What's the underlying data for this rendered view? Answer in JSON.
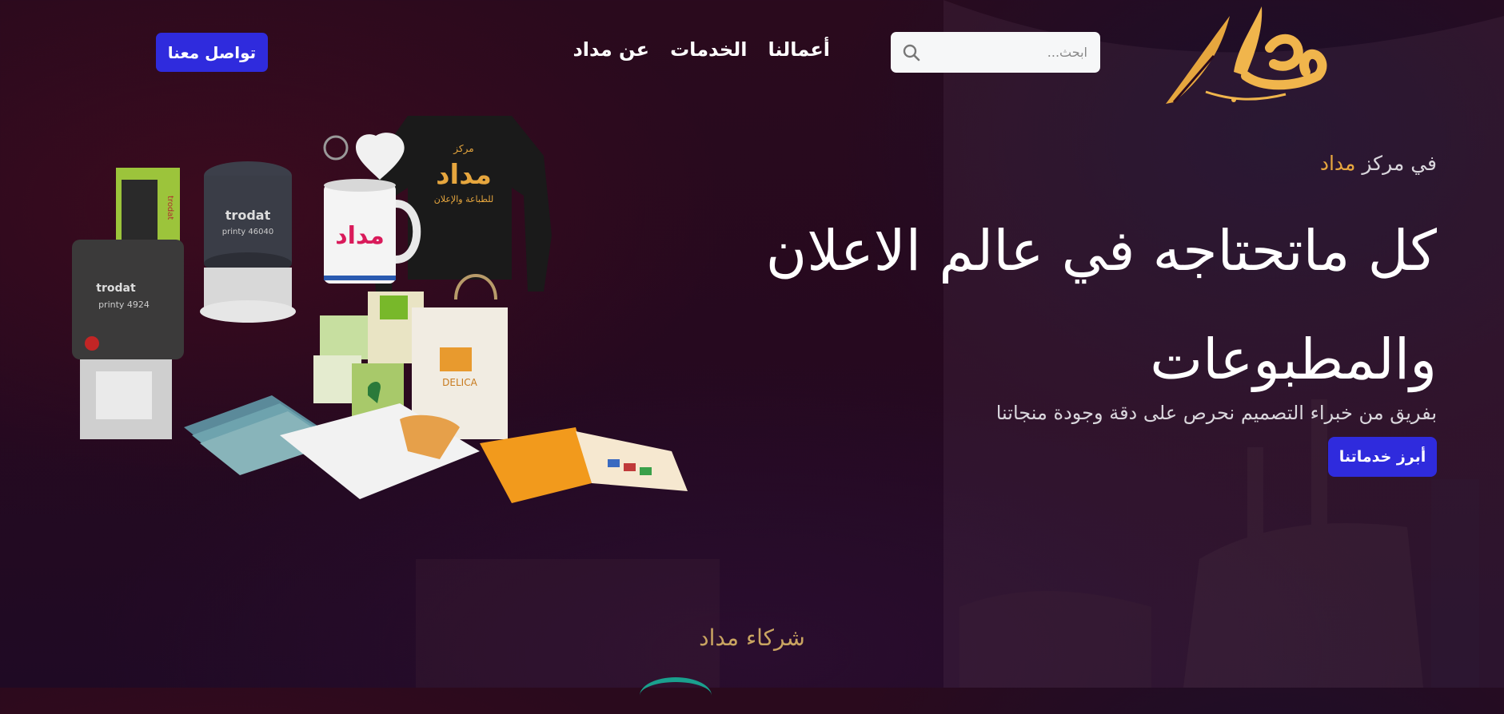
{
  "header": {
    "logo_alt": "مداد",
    "search": {
      "placeholder": "ابحث...",
      "value": ""
    },
    "nav": [
      {
        "label": "أعمالنا"
      },
      {
        "label": "الخدمات"
      },
      {
        "label": "عن مداد"
      }
    ],
    "contact_label": "تواصل معنا"
  },
  "hero": {
    "eyebrow_prefix": "في مركز",
    "eyebrow_brand": "مداد",
    "headline_line1": "كل ماتحتاجه في عالم الاعلان",
    "headline_line2": "والمطبوعات",
    "subtitle": "بفريق من خبراء التصميم نحرص على دقة وجودة منجاتنا",
    "cta_label": "أبرز خدماتنا"
  },
  "products_image": {
    "stamp_brand_1": "trodat",
    "stamp_model_1": "printy 4924",
    "stamp_brand_2": "trodat",
    "stamp_model_2": "printy 46040",
    "stamp_brand_3": "trodat",
    "mug_text": "مداد",
    "sweater_line1": "مركز",
    "sweater_line2": "مداد",
    "sweater_line3": "للطباعة والإعلان",
    "bag_text": "DELICA"
  },
  "partners": {
    "title": "شركاء مداد"
  },
  "colors": {
    "accent_blue": "#2f2bdd",
    "brand_gold": "#e6a63e",
    "partners_gold": "#c9a461"
  }
}
